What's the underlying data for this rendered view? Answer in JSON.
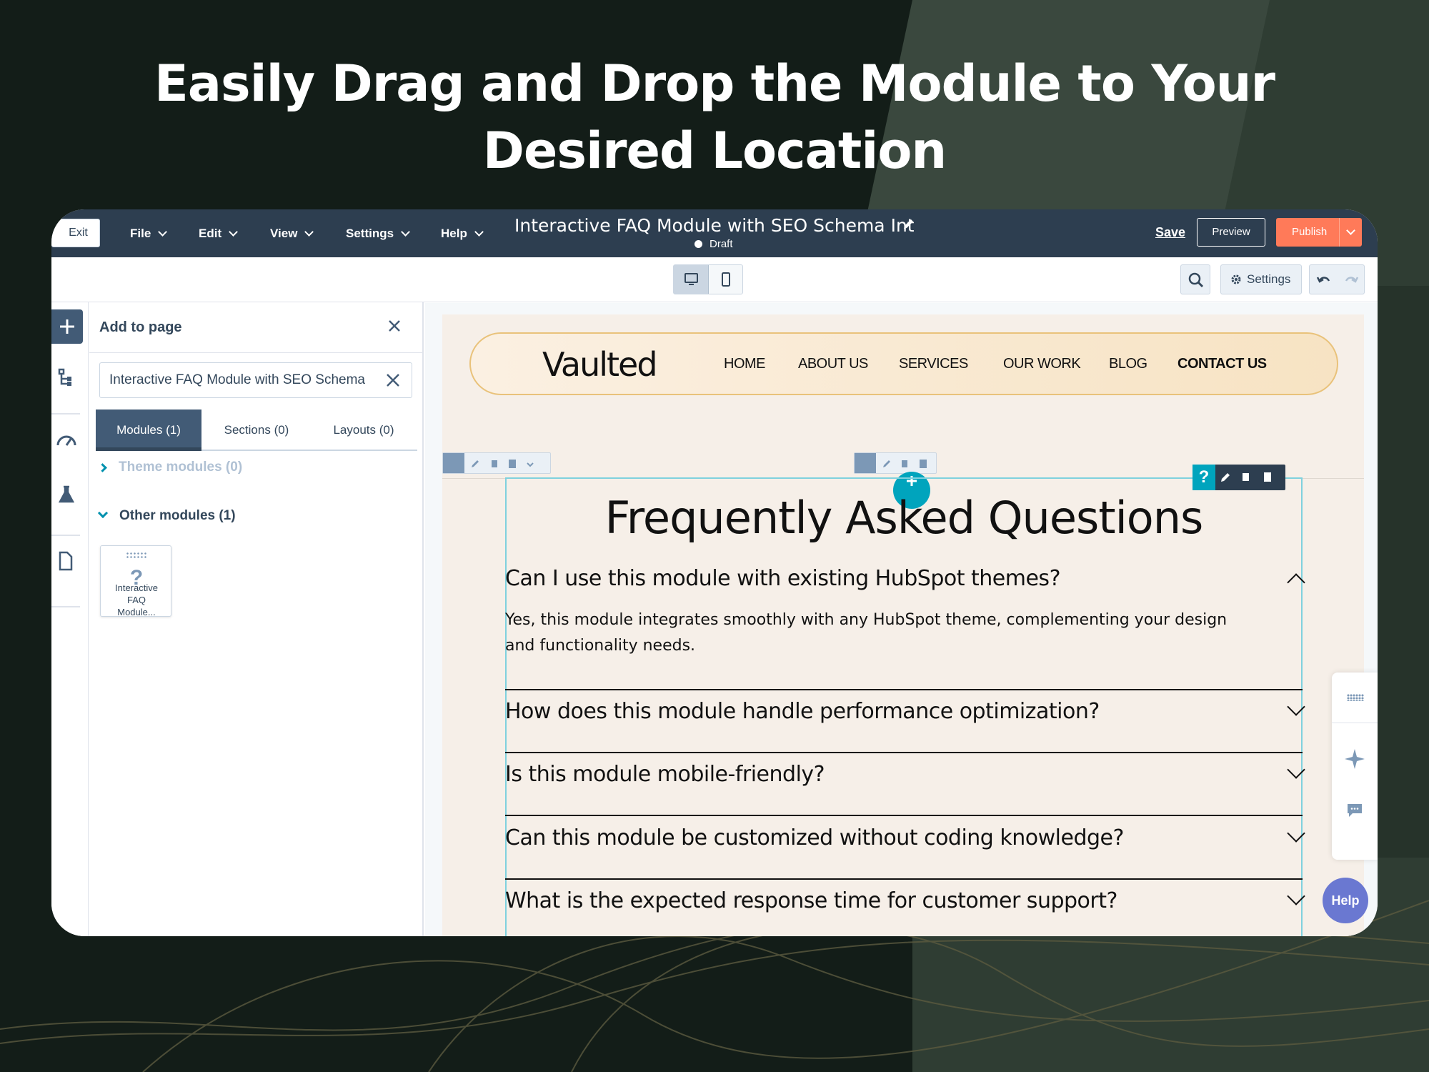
{
  "headline": {
    "line1": "Easily Drag and Drop the Module to Your",
    "line2": "Desired Location"
  },
  "topbar": {
    "exit_label": "Exit",
    "menus": [
      "File",
      "Edit",
      "View",
      "Settings",
      "Help"
    ],
    "page_title": "Interactive FAQ Module with SEO Schema Int",
    "status": "Draft",
    "save_label": "Save",
    "preview_label": "Preview",
    "publish_label": "Publish"
  },
  "toolbar": {
    "settings_label": "Settings"
  },
  "panel": {
    "title": "Add to page",
    "search_value": "Interactive FAQ Module with SEO Schema",
    "tabs": [
      "Modules (1)",
      "Sections (0)",
      "Layouts (0)"
    ],
    "active_tab": "Modules (1)",
    "theme_modules": "Theme modules (0)",
    "other_modules": "Other modules (1)",
    "module_card": {
      "label_line1": "Interactive",
      "label_line2": "FAQ",
      "label_line3": "Module..."
    }
  },
  "site": {
    "logo": "Vaulted",
    "nav": [
      "HOME",
      "ABOUT US",
      "SERVICES",
      "OUR WORK",
      "BLOG",
      "CONTACT US"
    ],
    "faq_title": "Frequently Asked Questions",
    "faqs": [
      {
        "question": "Can I use this module with existing HubSpot themes?",
        "answer": "Yes, this module integrates smoothly with any HubSpot theme, complementing your design and functionality needs.",
        "expanded": true
      },
      {
        "question": "How does this module handle performance optimization?",
        "expanded": false
      },
      {
        "question": "Is this module mobile-friendly?",
        "expanded": false
      },
      {
        "question": "Can this module be customized without coding knowledge?",
        "expanded": false
      },
      {
        "question": "What is the expected response time for customer support?",
        "expanded": false
      }
    ]
  },
  "help_label": "Help",
  "colors": {
    "topbar": "#2d3e50",
    "publish": "#ff7a59",
    "accent": "#00a4bd",
    "help": "#6a78d1",
    "page_bg": "#f6efe8"
  }
}
